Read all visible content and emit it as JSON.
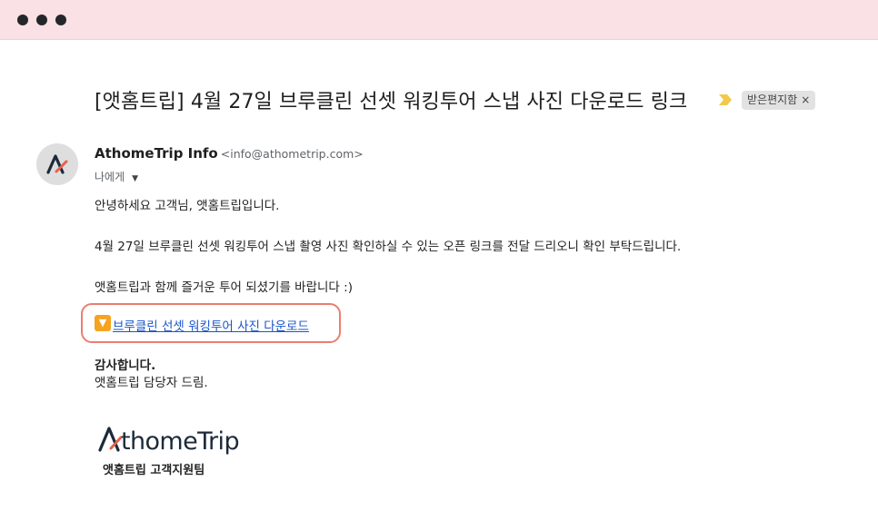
{
  "window": {
    "dots": [
      "close",
      "minimize",
      "maximize"
    ]
  },
  "email": {
    "subject": "[앳홈트립] 4월 27일 브루클린 선셋 워킹투어 스냅 사진 다운로드 링크",
    "label": "받은편지함",
    "label_close": "×",
    "sender_name": "AthomeTrip Info",
    "sender_email": "<info@athometrip.com>",
    "to": "나에게",
    "greeting": "안녕하세요 고객님, 앳홈트립입니다.",
    "body_line1": "4월 27일 브루클린 선셋 워킹투어 스냅 촬영 사진 확인하실 수 있는 오픈 링크를 전달 드리오니 확인 부탁드립니다.",
    "body_line2": "앳홈트립과 함께 즐거운 투어 되셨기를 바랍니다 :)",
    "link_icon": "🔽",
    "link_text": "브루클린 선셋 워킹투어 사진 다운로드 ",
    "closing1": "감사합니다.",
    "closing2": "앳홈트립 담당자  드림.",
    "signature_logo": "AthomeTrip",
    "signature_team": "앳홈트립 고객지원팀"
  },
  "colors": {
    "titlebar": "#f9e1e5",
    "link": "#1a55c8",
    "highlight_box": "#ea7e70",
    "importance": "#f2c94c"
  }
}
